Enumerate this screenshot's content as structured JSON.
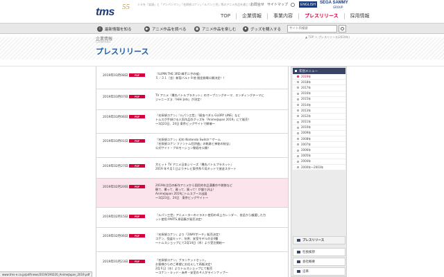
{
  "header": {
    "logo_text": "tms",
    "logo_anniv": "55",
    "tagline": "人々を「笑顔」と「アンパンマン」「名探偵コナン」「ルパン三世」等のアニメ作品を通じて…",
    "util_links": [
      "お問合せ",
      "サイトマップ"
    ],
    "english_label": "ENGLISH",
    "sega_label": "SEGA SAMMY",
    "sega_group": "GROUP",
    "nav": [
      "TOP",
      "企業情報",
      "事業内容",
      "プレスリリース",
      "採用情報"
    ],
    "nav_active_index": 3
  },
  "subnav": {
    "items": [
      "最新情報を知る",
      "アニメ作品を調べる",
      "アニメ作品を楽しむ",
      "グッズを購入する"
    ],
    "search_placeholder": "サイト内検索"
  },
  "title_area": {
    "jp_small": "企業情報",
    "en_small": "COMPANY",
    "page_title": "プレスリリース",
    "breadcrumb": "▲ TOP ＞ プレスリリース(2019年)"
  },
  "releases": [
    {
      "date": "2019年03月08日",
      "pdf": "PDF",
      "lines": [
        "『LUPIN THE 3RD 峰不二子の嘘』",
        "５／３１（金）新宿バルト９他 限定劇場公開決定！！"
      ],
      "highlight": false
    },
    {
      "date": "2019年03月07日",
      "pdf": "PDF",
      "lines": [
        "TV アニメ『爆丸バトルプラネット』のオープニングテーマ、エンディングテーマに",
        "ジャニーズ Jr.「HiHi Jets」が決定！"
      ],
      "highlight": false
    },
    {
      "date": "2019年03月06日",
      "pdf": "PDF",
      "lines": [
        "『名探偵コナン』『ルパン三世』『弱虫ペダル GLORY LINE』など",
        "トムスが手掛ける人気作品のグッズを「AnimeJapan 2019」にて販売！",
        "～3月23日、24日 東京ビッグサイトで開催～"
      ],
      "highlight": false
    },
    {
      "date": "2019年03月01日",
      "pdf": "PDF",
      "lines": [
        "『名探偵コナン』初の Nintendo Switch™ゲーム",
        "『名探偵コナン ファントム狂詩曲』の軌跡と神秘の秘宝』",
        "公式サイト・プロモーション動画を公開！"
      ],
      "highlight": false
    },
    {
      "date": "2019年02月27日",
      "pdf": "PDF",
      "lines": [
        "大ヒット TV アニメ日本シリーズ『爆丸バトルプラネット』",
        "2019 年４月１日よりテレビ東京系６局ネットで放送スタート"
      ],
      "highlight": false
    },
    {
      "date": "2019年02月20日",
      "pdf": "PDF",
      "lines": [
        "2019年注目の新作アニメから国民的作品漢書作や熱狼など",
        "観て、撮って、買って、買って！が盛り沢山！",
        "AnimeJapan 2019にトムスブース出展",
        "～3月23日、24日　東京ビッグサイト～"
      ],
      "highlight": true
    },
    {
      "date": "2019年02月15日",
      "pdf": "PDF",
      "lines": [
        "『ルパン三世』アニメーターのイラスト使用の卓上カレンダー、各話から厳選した力",
        "ット使用 PARTS 原画集が発売決定！"
      ],
      "highlight": false
    },
    {
      "date": "2019年02月06日",
      "pdf": "PDF",
      "lines": [
        "『名探偵コナン』より「2WAYポーチ」販売決定！",
        "コナン、怪盗キッド、灰原、安室モデルの全4種",
        "～トムスショップにて2月14日（木）より受注開始～"
      ],
      "highlight": false
    },
    {
      "date": "2019年01月23日",
      "pdf": "PDF",
      "lines": [
        "『名探偵コナン』ブランケットセット。",
        "お客様からのご希望にお応えして再販決定！",
        "2月６日（水）よりトムスショップにて販売",
        "～コナン・キッド・赤井・安室の４人がラインナップ～"
      ],
      "highlight": false
    }
  ],
  "sidebar": {
    "heading": "年別メニュー",
    "years": [
      "2019年",
      "2018年",
      "2017年",
      "2016年",
      "2015年",
      "2014年",
      "2013年",
      "2012年",
      "2011年",
      "2010年",
      "2009年",
      "2008年",
      "2007年",
      "2006年",
      "2005年",
      "2004年",
      "2000年〜2003年"
    ],
    "active_index": 0,
    "sections": [
      "プレスリリース",
      "社長挨拶",
      "会社概要",
      "沿革"
    ]
  },
  "status_bar": {
    "url": "www.tms-e.co.jp/pdf/news/2019/190220_AnimeJapan_2019.pdf"
  },
  "colors": {
    "brand_navy": "#1a3a7a",
    "accent_red": "#d6003b",
    "title_blue": "#1a5aa8",
    "highlight_pink": "#fbe4ec"
  }
}
